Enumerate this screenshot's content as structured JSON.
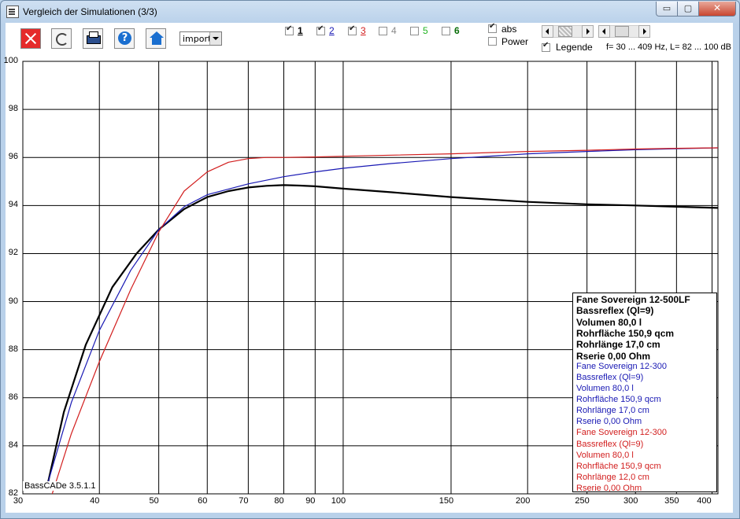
{
  "window": {
    "title": "Vergleich der Simulationen (3/3)",
    "min_label": "▭",
    "max_label": "▢",
    "close_label": "✕"
  },
  "toolbar": {
    "select_value": "import",
    "checkboxes": [
      {
        "label": "1",
        "checked": true,
        "color": "#000000"
      },
      {
        "label": "2",
        "checked": true,
        "color": "#1919b4"
      },
      {
        "label": "3",
        "checked": true,
        "color": "#d21e1e"
      },
      {
        "label": "4",
        "checked": false,
        "color": "#888888"
      },
      {
        "label": "5",
        "checked": false,
        "color": "#22b422"
      },
      {
        "label": "6",
        "checked": false,
        "color": "#0a6e0a"
      }
    ],
    "abs_label": "abs",
    "abs_checked": true,
    "power_label": "Power",
    "power_checked": false,
    "legende_label": "Legende",
    "legende_checked": true,
    "range_text": "f= 30 ... 409 Hz, L= 82 ... 100 dB"
  },
  "version_label": "BassCADe 3.5.1.1",
  "legend": {
    "entries": [
      {
        "style": "bold",
        "color": "#000000",
        "lines": [
          "Fane Sovereign 12-500LF",
          "Bassreflex (Ql=9)",
          "Volumen 80,0 l",
          "Rohrfläche 150,9 qcm",
          "Rohrlänge 17,0 cm",
          "Rserie 0,00 Ohm"
        ]
      },
      {
        "style": "blue",
        "color": "#1919b4",
        "lines": [
          "Fane Sovereign 12-300",
          "Bassreflex (Ql=9)",
          "Volumen 80,0 l",
          "Rohrfläche 150,9 qcm",
          "Rohrlänge 17,0 cm",
          "Rserie 0,00 Ohm"
        ]
      },
      {
        "style": "red",
        "color": "#d21e1e",
        "lines": [
          "Fane Sovereign 12-300",
          "Bassreflex (Ql=9)",
          "Volumen 80,0 l",
          "Rohrfläche 150,9 qcm",
          "Rohrlänge 12,0 cm",
          "Rserie 0,00 Ohm"
        ]
      }
    ]
  },
  "chart_data": {
    "type": "line",
    "x_scale": "log",
    "xlim": [
      30,
      409
    ],
    "ylim": [
      82,
      100
    ],
    "x_ticks": [
      30,
      40,
      50,
      60,
      70,
      80,
      90,
      100,
      150,
      200,
      250,
      300,
      350,
      400
    ],
    "y_ticks": [
      82,
      84,
      86,
      88,
      90,
      92,
      94,
      96,
      98,
      100
    ],
    "grid": true,
    "legend_placement": "bottom-right",
    "series": [
      {
        "color": "#000000",
        "width": 2.2,
        "x": [
          33,
          35,
          38,
          42,
          46,
          50,
          55,
          60,
          65,
          70,
          75,
          80,
          85,
          90,
          100,
          120,
          150,
          200,
          250,
          300,
          350,
          409
        ],
        "y": [
          82.5,
          85.4,
          88.2,
          90.6,
          92.0,
          93.0,
          93.85,
          94.35,
          94.6,
          94.75,
          94.82,
          94.85,
          94.83,
          94.8,
          94.7,
          94.55,
          94.35,
          94.15,
          94.05,
          94.0,
          93.95,
          93.9
        ]
      },
      {
        "color": "#1919b4",
        "width": 1.2,
        "x": [
          33,
          36,
          40,
          45,
          50,
          55,
          60,
          70,
          80,
          90,
          100,
          120,
          150,
          200,
          250,
          300,
          350,
          409
        ],
        "y": [
          82.5,
          85.8,
          88.8,
          91.3,
          93.0,
          93.95,
          94.45,
          94.9,
          95.2,
          95.4,
          95.55,
          95.75,
          95.95,
          96.15,
          96.25,
          96.32,
          96.36,
          96.4
        ]
      },
      {
        "color": "#d21e1e",
        "width": 1.2,
        "x": [
          33.5,
          36,
          40,
          45,
          50,
          55,
          60,
          65,
          70,
          75,
          80,
          90,
          100,
          150,
          200,
          250,
          300,
          350,
          409
        ],
        "y": [
          82,
          84.5,
          87.5,
          90.5,
          92.9,
          94.6,
          95.4,
          95.8,
          95.95,
          96.0,
          96.0,
          96.02,
          96.05,
          96.15,
          96.25,
          96.3,
          96.35,
          96.38,
          96.4
        ]
      }
    ]
  }
}
